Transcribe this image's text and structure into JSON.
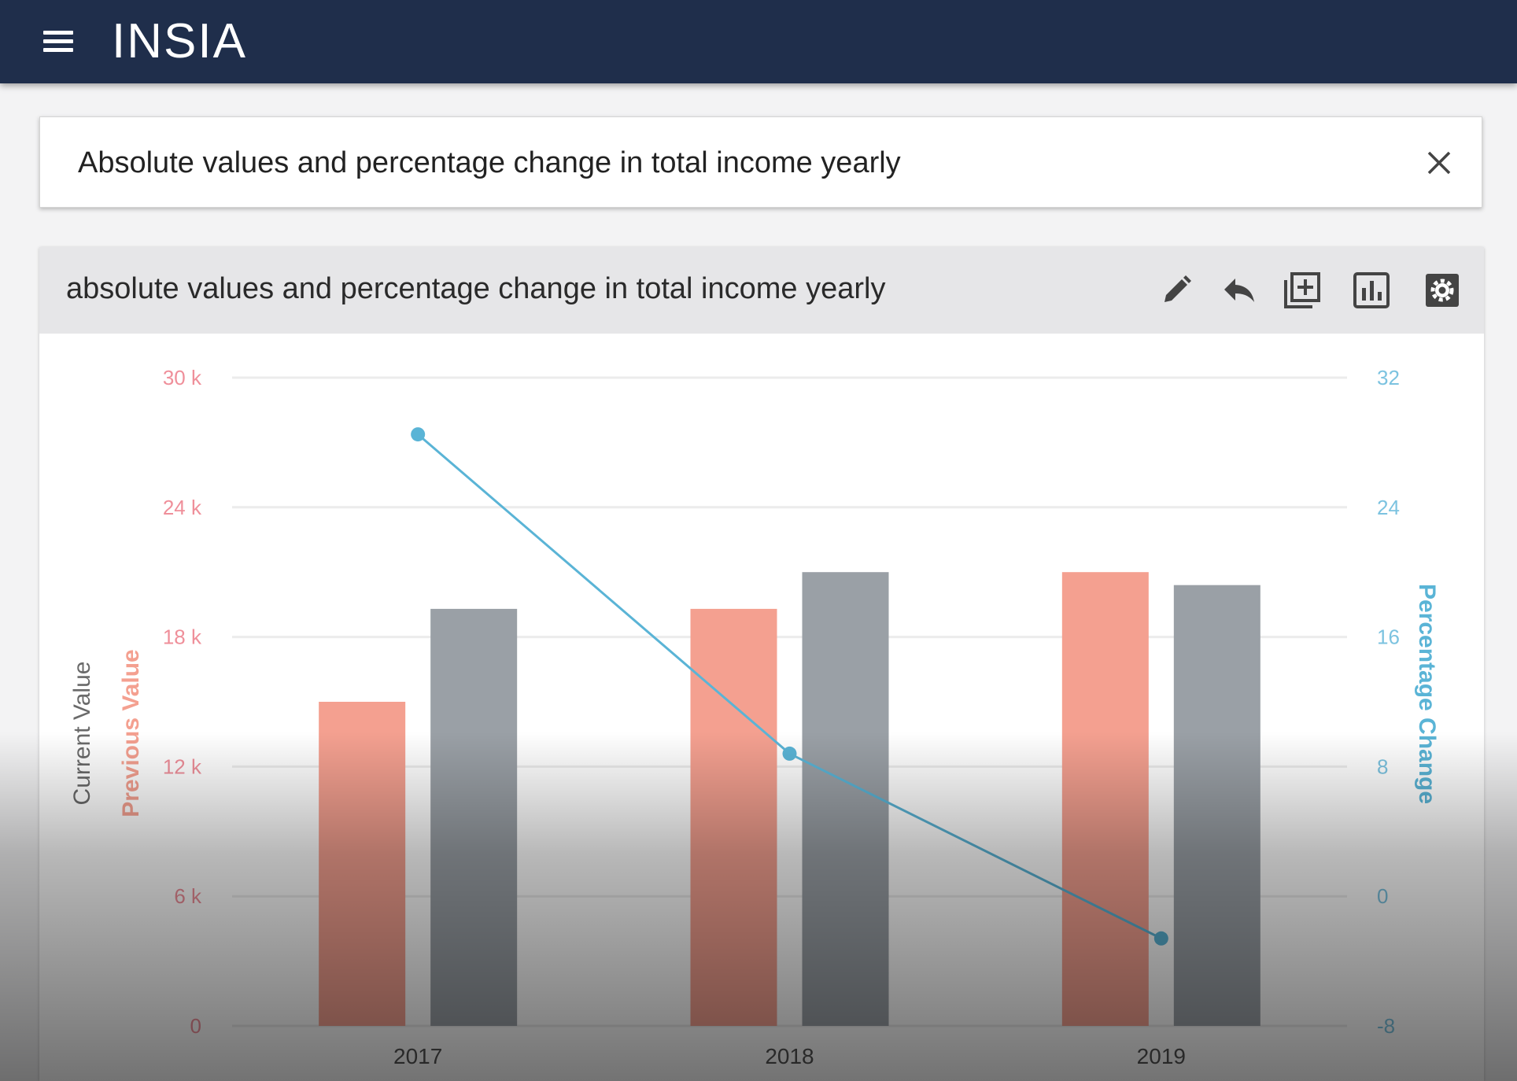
{
  "app": {
    "logo": "INSIA",
    "menu_icon": "hamburger-menu-icon"
  },
  "search": {
    "value": "Absolute values and percentage change in total income yearly",
    "clear_icon": "close-icon"
  },
  "card": {
    "title": "absolute values and percentage change in total income yearly",
    "tools": [
      "edit-pencil-icon",
      "undo-arrow-icon",
      "add-to-dashboard-icon",
      "chart-type-icon",
      "settings-gear-icon"
    ]
  },
  "colors": {
    "navbar": "#1f2e4b",
    "previous_value": "#f4a090",
    "current_value": "#9aa0a6",
    "percentage_change": "#5ab4d6",
    "left_axis_labels": "#ef8f9a",
    "right_axis_labels": "#7cc3e0",
    "current_axis_title": "#6a6a6a"
  },
  "chart_data": {
    "type": "bar",
    "categories": [
      "2017",
      "2018",
      "2019"
    ],
    "series": [
      {
        "name": "Previous Value",
        "type": "bar",
        "axis": "left",
        "values": [
          15000,
          19300,
          21000
        ]
      },
      {
        "name": "Current Value",
        "type": "bar",
        "axis": "left",
        "values": [
          19300,
          21000,
          20400
        ]
      },
      {
        "name": "Percentage Change",
        "type": "line",
        "axis": "right",
        "values": [
          28.5,
          8.8,
          -2.6
        ]
      }
    ],
    "left_axis": {
      "titles": [
        "Current Value",
        "Previous Value"
      ],
      "ticks": [
        "0",
        "6 k",
        "12 k",
        "18 k",
        "24 k",
        "30 k"
      ],
      "tick_values": [
        0,
        6000,
        12000,
        18000,
        24000,
        30000
      ],
      "range": [
        0,
        30000
      ]
    },
    "right_axis": {
      "title": "Percentage Change",
      "ticks": [
        "-8",
        "0",
        "8",
        "16",
        "24",
        "32"
      ],
      "tick_values": [
        -8,
        0,
        8,
        16,
        24,
        32
      ],
      "range": [
        -8,
        32
      ]
    },
    "grid": true,
    "legend": "none"
  }
}
